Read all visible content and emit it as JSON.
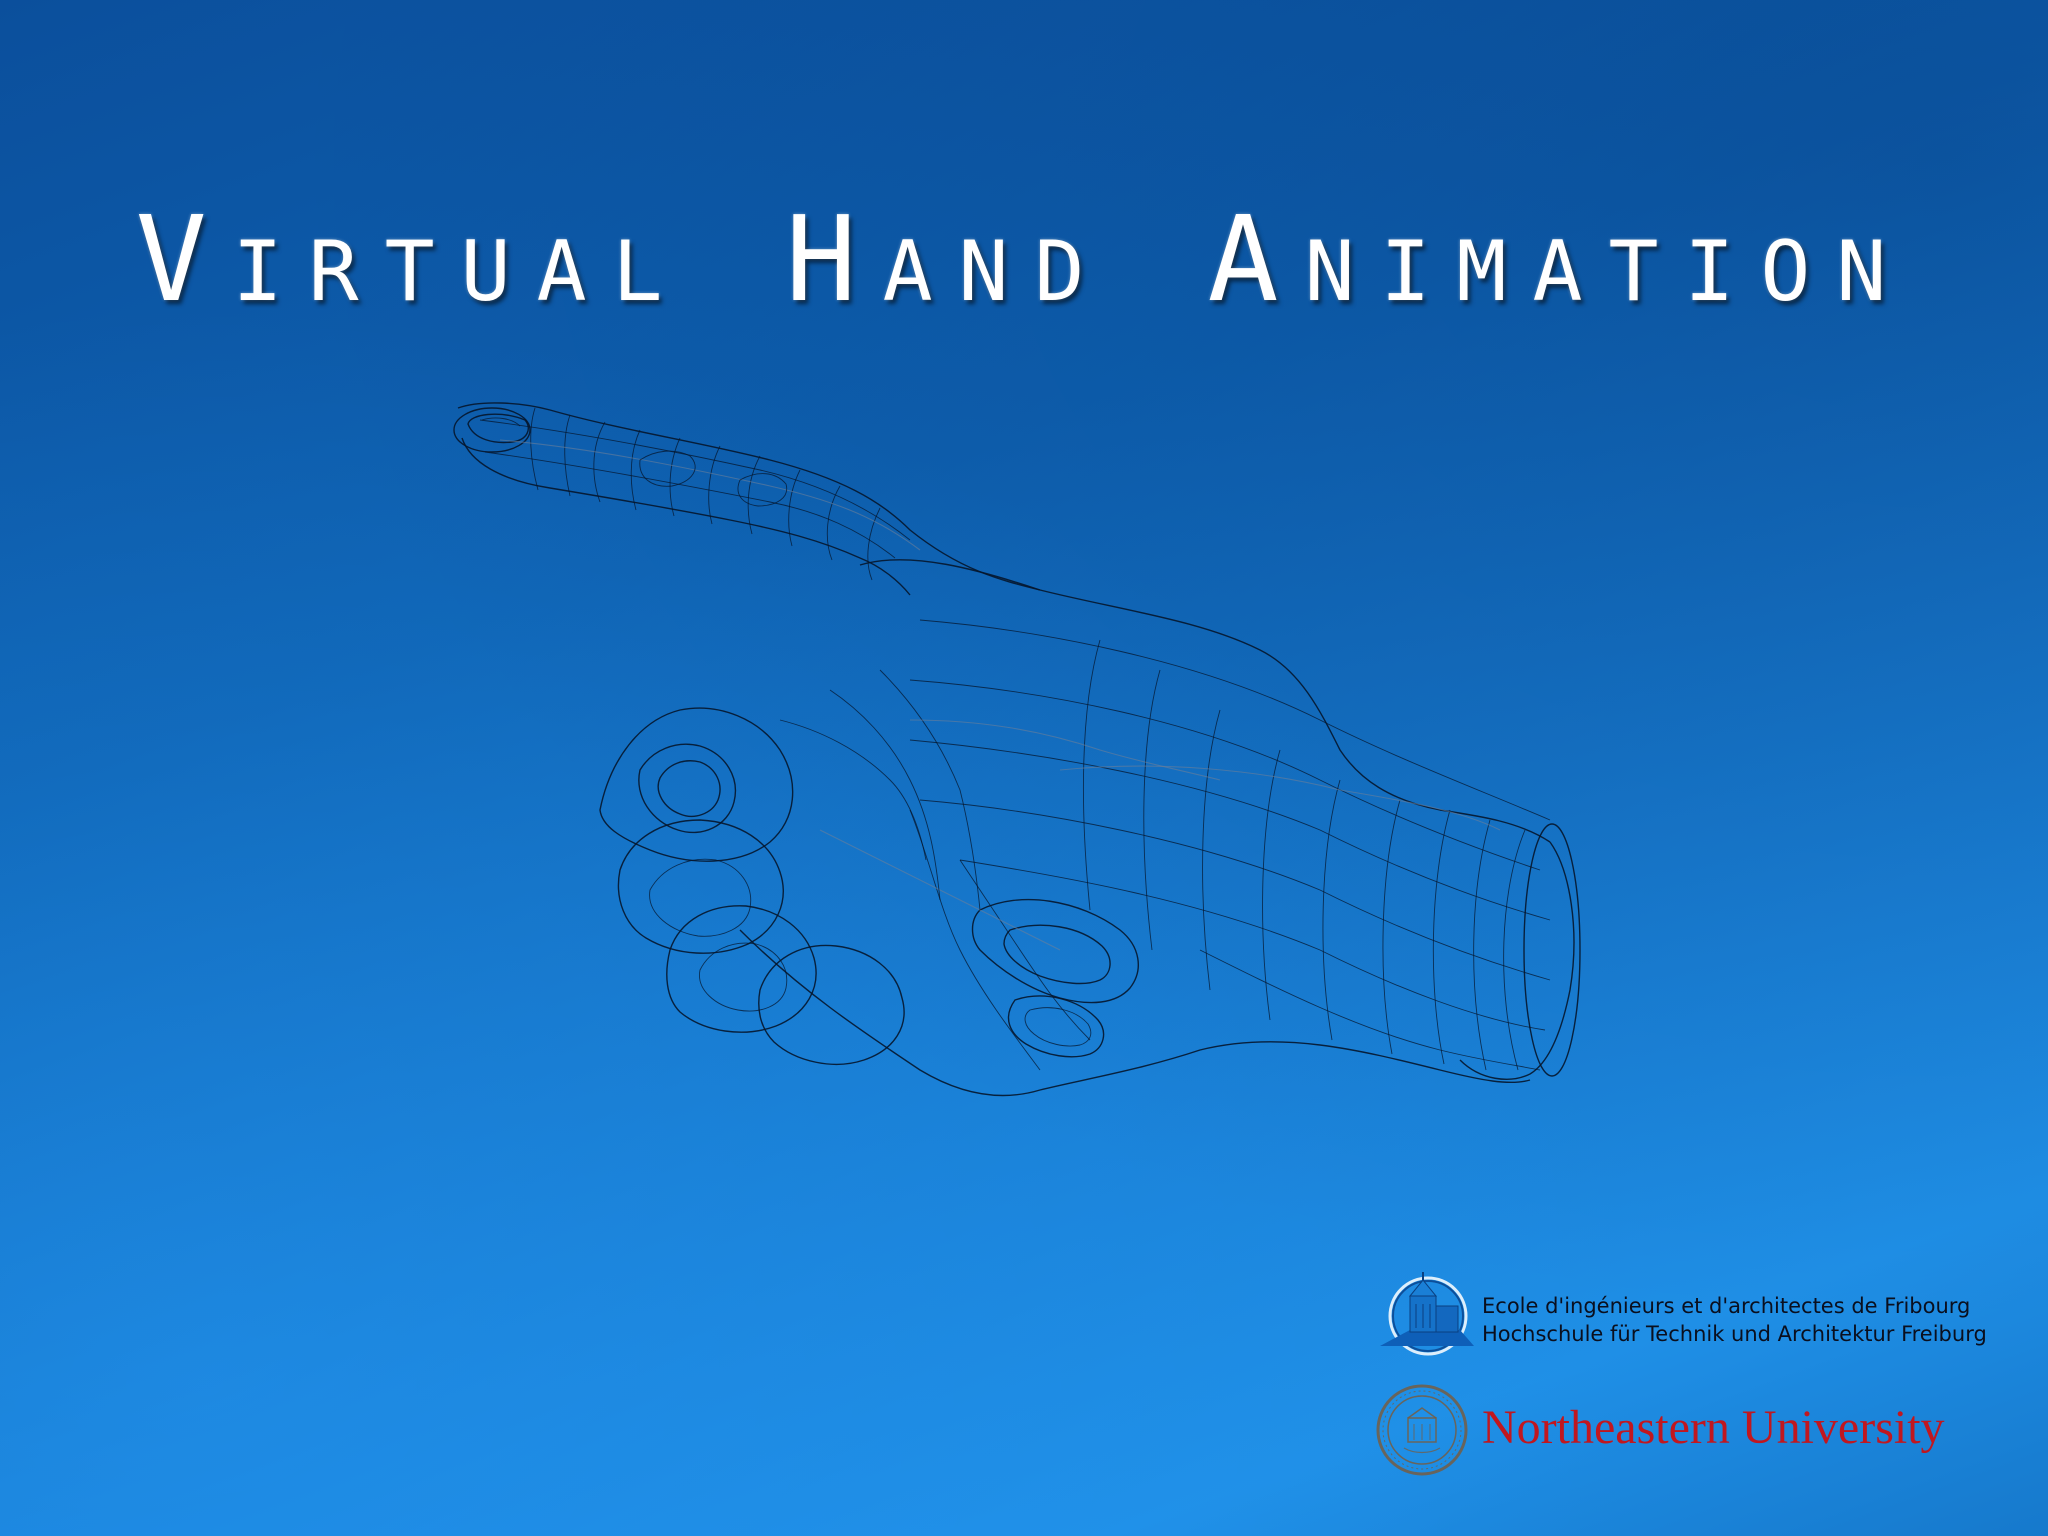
{
  "title": "Virtual Hand Animation",
  "illustration": {
    "icon": "wireframe-pointing-hand-icon"
  },
  "logos": {
    "heia": {
      "icon": "heia-fribourg-building-icon",
      "line1": "Ecole d'ingénieurs et d'architectes de Fribourg",
      "line2": "Hochschule für Technik und Architektur Freiburg"
    },
    "northeastern": {
      "icon": "northeastern-university-seal-icon",
      "name": "Northeastern University"
    }
  },
  "colors": {
    "background_top": "#0b4f9c",
    "background_bottom": "#1f8fe6",
    "title": "#ffffff",
    "wireframe": "#06162c",
    "northeastern_red": "#c1171f"
  }
}
